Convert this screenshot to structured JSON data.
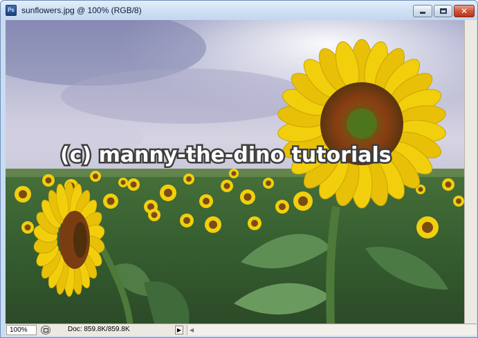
{
  "window": {
    "app_icon": "photoshop-document-icon",
    "app_icon_text": "Ps",
    "title": "sunflowers.jpg @ 100% (RGB/8)",
    "minimize_icon": "minimize-icon",
    "maximize_icon": "maximize-icon",
    "close_icon": "close-icon",
    "close_glyph": "✕"
  },
  "canvas": {
    "watermark_text": "(c) manny-the-dino tutorials",
    "colors": {
      "sky_top": "#8b8fb7",
      "sky_light": "#f2f1f4",
      "field_green": "#3e6a35",
      "petal_yellow": "#f2cf0c",
      "center_brown": "#7b4b16"
    }
  },
  "status_bar": {
    "zoom_value": "100%",
    "status_icon": "status-info-icon",
    "doc_info": "Doc: 859.8K/859.8K",
    "menu_icon": "play-arrow-icon",
    "menu_glyph": "▶",
    "scroll_left_glyph": "◀"
  }
}
